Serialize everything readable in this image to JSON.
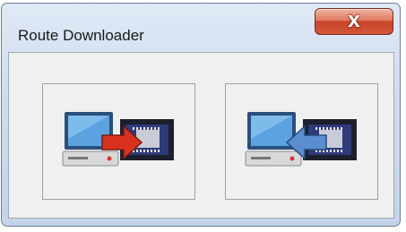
{
  "window": {
    "title": "Route Downloader",
    "close_label": "X"
  },
  "buttons": [
    {
      "icon": "upload-to-device-icon",
      "arrow": "right",
      "arrow_color": "#d8321e"
    },
    {
      "icon": "download-from-device-icon",
      "arrow": "left",
      "arrow_color": "#5a8ed0"
    }
  ]
}
